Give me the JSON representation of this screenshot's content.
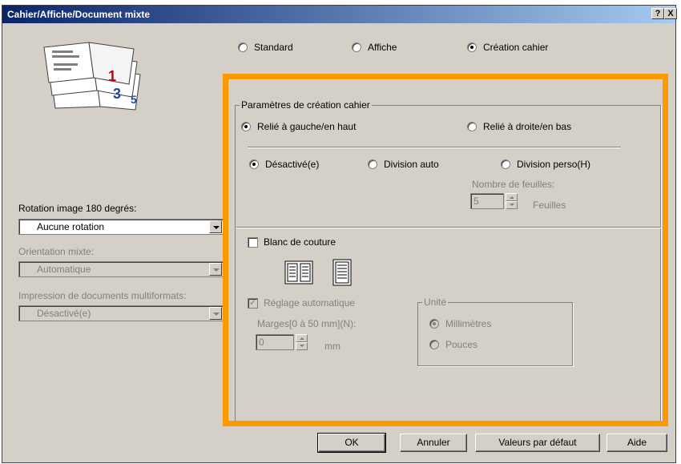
{
  "window": {
    "title": "Cahier/Affiche/Document mixte",
    "help_btn": "?",
    "close_btn": "X"
  },
  "layout_mode": {
    "standard": "Standard",
    "affiche": "Affiche",
    "creation_cahier": "Création cahier",
    "selected": "creation_cahier"
  },
  "preview": {
    "page_numbers": [
      "1",
      "3",
      "5"
    ]
  },
  "left": {
    "rotation_label": "Rotation image 180 degrés:",
    "rotation_value": "Aucune rotation",
    "orientation_label": "Orientation mixte:",
    "orientation_value": "Automatique",
    "multiformat_label": "Impression de documents multiformats:",
    "multiformat_value": "Désactivé(e)"
  },
  "booklet": {
    "group_title": "Paramètres de création cahier",
    "binding_left": "Relié à gauche/en haut",
    "binding_right": "Relié à droite/en bas",
    "binding_selected": "left",
    "division_off": "Désactivé(e)",
    "division_auto": "Division auto",
    "division_custom": "Division perso(H)",
    "division_selected": "off",
    "sheets_label": "Nombre de feuilles:",
    "sheets_value": "5",
    "sheets_unit": "Feuilles",
    "gutter_label": "Blanc de couture",
    "gutter_checked": false,
    "auto_adjust": "Réglage automatique",
    "auto_adjust_checked": true,
    "margin_label": "Marges[0 à 50 mm](N):",
    "margin_value": "0",
    "margin_unit": "mm",
    "unit_group": "Unité",
    "unit_mm": "Millimètres",
    "unit_inch": "Pouces",
    "unit_selected": "mm"
  },
  "buttons": {
    "ok": "OK",
    "cancel": "Annuler",
    "defaults": "Valeurs par défaut",
    "help": "Aide"
  },
  "colors": {
    "highlight": "#ff9900",
    "dialog_bg": "#d4d0c8",
    "title_start": "#0a246a",
    "title_end": "#a6caf0"
  }
}
